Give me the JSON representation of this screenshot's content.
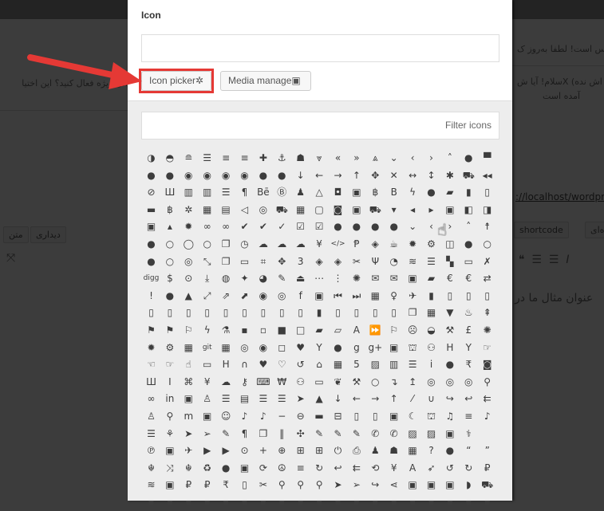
{
  "background": {
    "notice": "س است! لطفا به‌روز ک",
    "notice_link": "لطفا به‌روز ک",
    "comment": "اش نده) Xسلام! آیا ش",
    "comment2": "آمده است",
    "left_text": "انی ویژه فعال کنید؟ این اختیا",
    "url": "://localhost/wordpres",
    "shortcode_btn": "shortcode",
    "other_btn": "ه‌ای",
    "tab_visual": "دیداری",
    "tab_text": "متن",
    "title_text": "عنوان مثال ما در"
  },
  "modal": {
    "icon_label": "Icon",
    "icon_value": "",
    "icon_picker_button": "Icon picker",
    "media_manager_button": "Media manage",
    "filter_placeholder": "Filter icons"
  },
  "highlight_color": "#e53935",
  "icon_grid": {
    "rows": [
      [
        "◑",
        "◓",
        "≘",
        "☰",
        "≡",
        "≡",
        "✚",
        "⚓",
        "☗",
        "⩔",
        "«",
        "»",
        "⩓",
        "⌄",
        "‹",
        "›",
        "˄",
        "●",
        "▀"
      ],
      [
        "●",
        "●",
        "◉",
        "◉",
        "◉",
        "◉",
        "●",
        "●",
        "↓",
        "←",
        "→",
        "↑",
        "✥",
        "✕",
        "↔",
        "↕",
        "✱",
        "⛟",
        "◂◂"
      ],
      [
        "⊘",
        "Ш",
        "▥",
        "▥",
        "☰",
        "¶",
        "Bē",
        "Ⓑ",
        "♟",
        "△",
        "◘",
        "▣",
        "฿",
        "B",
        "ϟ",
        "●",
        "▰",
        "▮",
        "▯"
      ],
      [
        "▬",
        "฿",
        "✲",
        "▦",
        "▤",
        "◁",
        "◎",
        "⛟",
        "▦",
        "▢",
        "◙",
        "▣",
        "⛟",
        "▾",
        "◂",
        "▸",
        "▣",
        "◧",
        "◨"
      ],
      [
        "▣",
        "▴",
        "✹",
        "∞",
        "∞",
        "✔",
        "✔",
        "✓",
        "☑",
        "☑",
        "●",
        "●",
        "●",
        "●",
        "⌄",
        "‹",
        "›",
        "˄",
        "☨"
      ],
      [
        "●",
        "○",
        "◯",
        "○",
        "❐",
        "◷",
        "☁",
        "☁",
        "☁",
        "¥",
        "</>",
        "Ᵽ",
        "◈",
        "☕",
        "✹",
        "⚙",
        "◫",
        "●",
        "○"
      ],
      [
        "●",
        "○",
        "◎",
        "⤡",
        "❐",
        "▭",
        "⌗",
        "✥",
        "3",
        "◈",
        "◈",
        "✂",
        "Ψ",
        "◔",
        "≋",
        "☰",
        "▚",
        "▭",
        "✗"
      ],
      [
        "digg",
        "$",
        "⊙",
        "⤓",
        "◍",
        "✦",
        "◕",
        "✎",
        "⏏",
        "⋯",
        "⋮",
        "✺",
        "✉",
        "✉",
        "▣",
        "▰",
        "€",
        "€",
        "⇄"
      ],
      [
        "!",
        "●",
        "▲",
        "⤢",
        "⇗",
        "⬈",
        "◉",
        "◎",
        "f",
        "▣",
        "⏮",
        "⏭",
        "▦",
        "♀",
        "✈",
        "▮",
        "▯",
        "▯",
        "▯"
      ],
      [
        "▯",
        "▯",
        "▯",
        "▯",
        "▯",
        "▯",
        "▯",
        "▯",
        "▯",
        "▮",
        "▯",
        "▯",
        "▯",
        "▯",
        "❐",
        "▦",
        "▼",
        "♨",
        "⇞"
      ],
      [
        "⚑",
        "⚑",
        "⚐",
        "ϟ",
        "⚗",
        "▪",
        "▫",
        "■",
        "□",
        "▰",
        "▱",
        "A",
        "⏩",
        "⚐",
        "☹",
        "◒",
        "⚒",
        "£",
        "✺"
      ],
      [
        "✹",
        "⚙",
        "▦",
        "git",
        "▦",
        "◎",
        "◉",
        "◻",
        "♥",
        "Y",
        "●",
        "g",
        "g+",
        "▣",
        "⛫",
        "⚇",
        "H",
        "Y",
        "☞"
      ],
      [
        "☜",
        "☞",
        "☝",
        "▭",
        "H",
        "∩",
        "♥",
        "♡",
        "↺",
        "⌂",
        "▦",
        "5",
        "▨",
        "▥",
        "☰",
        "i",
        "●",
        "₹",
        "◙"
      ],
      [
        "Ш",
        "I",
        "⌘",
        "¥",
        "☁",
        "⚷",
        "⌨",
        "₩",
        "⚇",
        "▭",
        "❦",
        "⚒",
        "○",
        "↴",
        "↥",
        "◎",
        "◎",
        "◎",
        "⚲"
      ],
      [
        "∞",
        "in",
        "▣",
        "♙",
        "☰",
        "▤",
        "☰",
        "☰",
        "➤",
        "▲",
        "↓",
        "←",
        "→",
        "↑",
        "⁄",
        "∪",
        "↪",
        "↩",
        "⇇"
      ],
      [
        "♙",
        "⚲",
        "m",
        "▣",
        "☺",
        "♪",
        "♪",
        "−",
        "⊖",
        "▬",
        "⊟",
        "▯",
        "▯",
        "▣",
        "☾",
        "⛫",
        "♫",
        "≡",
        "♪"
      ],
      [
        "☰",
        "⚘",
        "➤",
        "➢",
        "✎",
        "¶",
        "❐",
        "‖",
        "✣",
        "✎",
        "✎",
        "✎",
        "✆",
        "✆",
        "▨",
        "▨",
        "▣",
        "⚕",
        ""
      ],
      [
        "℗",
        "▣",
        "✈",
        "▶",
        "▶",
        "⊙",
        "+",
        "⊕",
        "⊞",
        "⊞",
        "⏻",
        "⎙",
        "♟",
        "☗",
        "▦",
        "?",
        "●",
        "“",
        "”"
      ],
      [
        "☬",
        "⤨",
        "☬",
        "♻",
        "●",
        "▣",
        "⟳",
        "☮",
        "≡",
        "↻",
        "↩",
        "⇇",
        "⟲",
        "¥",
        "A",
        "➶",
        "↺",
        "↻",
        "₽"
      ],
      [
        "≋",
        "▣",
        "₽",
        "₽",
        "₹",
        "▯",
        "✂",
        "⚲",
        "⚲",
        "⚲",
        "➤",
        "➢",
        "↪",
        "⋖",
        "▣",
        "▣",
        "▣",
        "◗",
        "⛟"
      ],
      [
        "▪",
        "▪",
        "▪",
        "▪",
        "▪",
        "▪",
        "▪",
        "▪",
        "▪",
        "▪",
        "▪",
        "▪",
        "▪",
        "▪",
        "▪",
        "▪",
        "▪",
        "▪",
        "▪"
      ]
    ]
  }
}
